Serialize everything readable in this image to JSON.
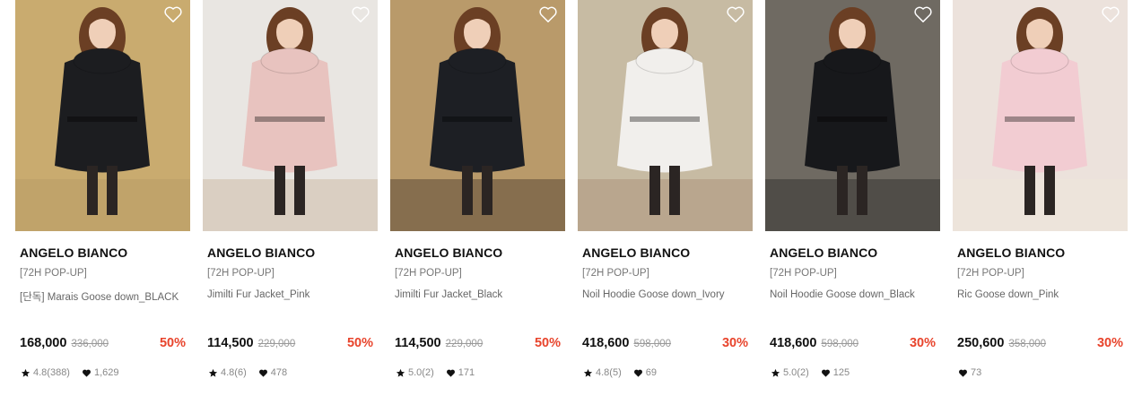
{
  "products": [
    {
      "brand": "ANGELO BIANCO",
      "tag": "[72H POP-UP]",
      "name": "[단독] Marais Goose down_BLACK",
      "price": "168,000",
      "original_price": "336,000",
      "discount": "50%",
      "rating": "4.8(388)",
      "likes": "1,629",
      "bg": "#c9ab6f",
      "coat": "#1c1d20",
      "accent": "#b69a63"
    },
    {
      "brand": "ANGELO BIANCO",
      "tag": "[72H POP-UP]",
      "name": "Jimilti Fur Jacket_Pink",
      "price": "114,500",
      "original_price": "229,000",
      "discount": "50%",
      "rating": "4.8(6)",
      "likes": "478",
      "bg": "#e9e6e2",
      "coat": "#e8c3bf",
      "accent": "#c7b49c"
    },
    {
      "brand": "ANGELO BIANCO",
      "tag": "[72H POP-UP]",
      "name": "Jimilti Fur Jacket_Black",
      "price": "114,500",
      "original_price": "229,000",
      "discount": "50%",
      "rating": "5.0(2)",
      "likes": "171",
      "bg": "#b99a6a",
      "coat": "#1d1f24",
      "accent": "#4a3a2c"
    },
    {
      "brand": "ANGELO BIANCO",
      "tag": "[72H POP-UP]",
      "name": "Noil Hoodie Goose down_Ivory",
      "price": "418,600",
      "original_price": "598,000",
      "discount": "30%",
      "rating": "4.8(5)",
      "likes": "69",
      "bg": "#c7bba3",
      "coat": "#f1efec",
      "accent": "#a88f75"
    },
    {
      "brand": "ANGELO BIANCO",
      "tag": "[72H POP-UP]",
      "name": "Noil Hoodie Goose down_Black",
      "price": "418,600",
      "original_price": "598,000",
      "discount": "30%",
      "rating": "5.0(2)",
      "likes": "125",
      "bg": "#6f6a62",
      "coat": "#17181b",
      "accent": "#2a2a2a"
    },
    {
      "brand": "ANGELO BIANCO",
      "tag": "[72H POP-UP]",
      "name": "Ric Goose down_Pink",
      "price": "250,600",
      "original_price": "358,000",
      "discount": "30%",
      "rating": "",
      "likes": "73",
      "bg": "#ece2dc",
      "coat": "#f2ccd2",
      "accent": "#efe6da"
    }
  ],
  "colors": {
    "discount": "#e8442c",
    "skin": "#efcfb8",
    "hair": "#6b3f24"
  },
  "icons": {
    "wishlist": "heart-outline-icon",
    "rating": "star-icon",
    "likes": "heart-filled-icon"
  }
}
